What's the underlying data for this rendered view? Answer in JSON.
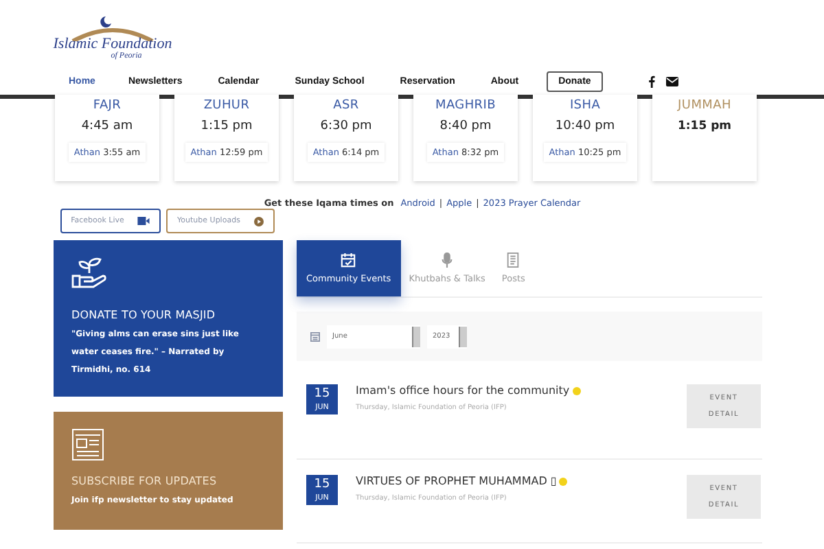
{
  "logo": {
    "title": "Islamic Foundation",
    "subtitle": "of Peoria"
  },
  "nav": [
    {
      "label": "Home",
      "selected": true,
      "kind": "link"
    },
    {
      "label": "Newsletters",
      "selected": false,
      "kind": "link"
    },
    {
      "label": "Calendar",
      "selected": false,
      "kind": "link"
    },
    {
      "label": "Sunday School",
      "selected": false,
      "kind": "link"
    },
    {
      "label": "Reservation",
      "selected": false,
      "kind": "link"
    },
    {
      "label": "About",
      "selected": false,
      "kind": "link"
    },
    {
      "label": "Donate",
      "selected": false,
      "kind": "button"
    }
  ],
  "prayers": [
    {
      "name": "FAJR",
      "time": "4:45 am",
      "athan_label": "Athan",
      "athan": "3:55 am",
      "kind": "daily"
    },
    {
      "name": "ZUHUR",
      "time": "1:15 pm",
      "athan_label": "Athan",
      "athan": "12:59 pm",
      "kind": "daily"
    },
    {
      "name": "ASR",
      "time": "6:30 pm",
      "athan_label": "Athan",
      "athan": "6:14 pm",
      "kind": "daily"
    },
    {
      "name": "MAGHRIB",
      "time": "8:40 pm",
      "athan_label": "Athan",
      "athan": "8:32 pm",
      "kind": "daily"
    },
    {
      "name": "ISHA",
      "time": "10:40 pm",
      "athan_label": "Athan",
      "athan": "10:25 pm",
      "kind": "daily"
    },
    {
      "name": "JUMMAH",
      "time": "1:15 pm",
      "kind": "friday"
    }
  ],
  "iqama": {
    "text": "Get these Iqama times on",
    "links": [
      "Android",
      "Apple",
      "2023 Prayer Calendar"
    ],
    "separator": "|"
  },
  "media_buttons": [
    {
      "label": "Facebook Live",
      "kind": "facebook"
    },
    {
      "label": "Youtube Uploads",
      "kind": "youtube"
    }
  ],
  "donate_card": {
    "title": "DONATE TO YOUR MASJID",
    "quote": "\"Giving alms can erase sins just like water ceases fire.\" – Narrated by Tirmidhi,  no. 614"
  },
  "subscribe_card": {
    "title": "SUBSCRIBE FOR UPDATES",
    "text": "Join ifp newsletter to stay updated"
  },
  "tabs": [
    {
      "label": "Community Events",
      "selected": true,
      "kind": "calendar"
    },
    {
      "label": "Khutbahs & Talks",
      "selected": false,
      "kind": "mic"
    },
    {
      "label": "Posts",
      "selected": false,
      "kind": "doc"
    }
  ],
  "filter": {
    "month": "June",
    "year": "2023"
  },
  "events": [
    {
      "day": "15",
      "month": "JUN",
      "title": "Imam's office hours for the community",
      "subtitle": "Thursday, Islamic Foundation of Peoria (IFP)",
      "color": "#f2d21b",
      "button": [
        "EVENT",
        "DETAIL"
      ]
    },
    {
      "day": "15",
      "month": "JUN",
      "title": "VIRTUES OF PROPHET MUHAMMAD ▯",
      "subtitle": "Thursday, Islamic Foundation of Peoria (IFP)",
      "color": "#f2d21b",
      "button": [
        "EVENT",
        "DETAIL"
      ]
    }
  ]
}
